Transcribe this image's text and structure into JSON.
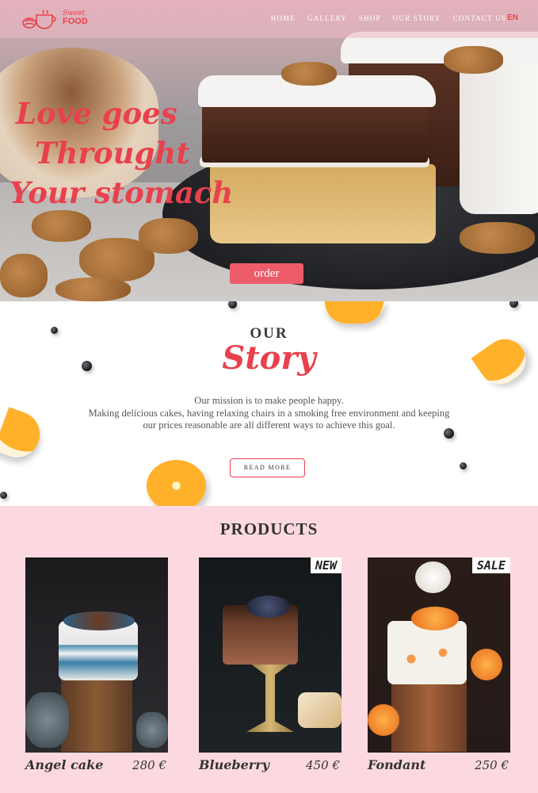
{
  "nav": {
    "logo_sweet": "Sweet",
    "logo_food": "FOOD",
    "menu": [
      "HOME",
      "GALLERY",
      "SHOP",
      "OUR STORY",
      "CONTACT US"
    ],
    "lang": "EN"
  },
  "hero": {
    "title_line1": "Love goes",
    "title_line2": "Throught",
    "title_line3": "Your stomach",
    "order_label": "order"
  },
  "story": {
    "our": "OUR",
    "title": "Story",
    "line1": "Our mission is to make people happy.",
    "line2": "Making delicious cakes, having relaxing chairs in a smoking free environment and keeping",
    "line3": "our prices reasonable are all different ways to achieve this goal.",
    "read_more": "READ MORE"
  },
  "products": {
    "title": "PRODUCTS",
    "items": [
      {
        "name": "Angel cake",
        "price": "280 €",
        "badge": ""
      },
      {
        "name": "Blueberry",
        "price": "450 €",
        "badge": "NEW"
      },
      {
        "name": "Fondant",
        "price": "250 €",
        "badge": "SALE"
      }
    ]
  },
  "colors": {
    "accent": "#e8414d",
    "products_bg": "#fcd9e0"
  },
  "icons": [
    "cup-cake-logo-icon"
  ]
}
